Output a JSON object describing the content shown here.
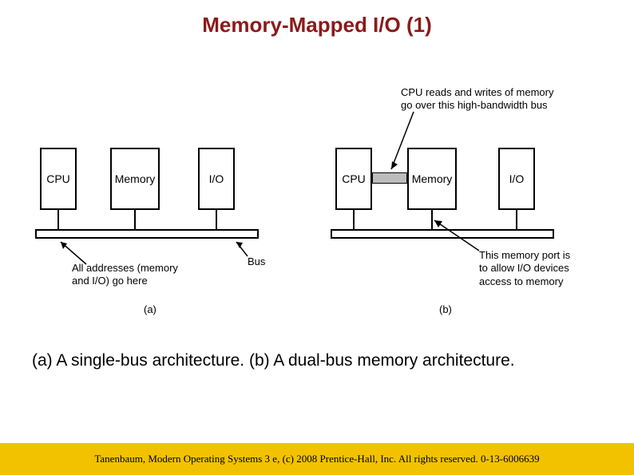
{
  "title": "Memory-Mapped I/O (1)",
  "diagram": {
    "left": {
      "cpu": "CPU",
      "memory": "Memory",
      "io": "I/O",
      "bus_label": "Bus",
      "annotation": "All addresses (memory\nand I/O) go here",
      "fig_label": "(a)"
    },
    "right": {
      "cpu": "CPU",
      "memory": "Memory",
      "io": "I/O",
      "top_annotation": "CPU reads and writes of memory\ngo over this high-bandwidth bus",
      "bottom_annotation": "This memory port is\nto allow I/O devices\naccess to memory",
      "fig_label": "(b)"
    }
  },
  "caption": "(a) A single-bus architecture. (b) A dual-bus memory architecture.",
  "footer": "Tanenbaum, Modern Operating Systems 3 e, (c) 2008 Prentice-Hall, Inc. All rights reserved. 0-13-6006639"
}
